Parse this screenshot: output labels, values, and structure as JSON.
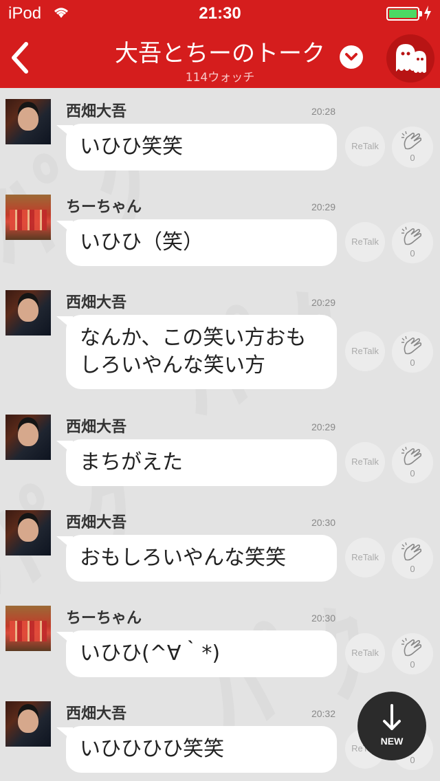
{
  "status_bar": {
    "carrier": "iPod",
    "time": "21:30",
    "battery_level": 1.0
  },
  "header": {
    "title": "大吾とちーのトーク",
    "subtitle": "114ウォッチ"
  },
  "messages": [
    {
      "sender": "西畑大吾",
      "time": "20:28",
      "text": "いひひ笑笑",
      "retalk_label": "ReTalk",
      "clap_count": "0"
    },
    {
      "sender": "ちーちゃん",
      "time": "20:29",
      "text": "いひひ（笑）",
      "retalk_label": "ReTalk",
      "clap_count": "0"
    },
    {
      "sender": "西畑大吾",
      "time": "20:29",
      "text_line1": "なんか、この笑い方おも",
      "text_line2": "しろいやんな笑い方",
      "retalk_label": "ReTalk",
      "clap_count": "0"
    },
    {
      "sender": "西畑大吾",
      "time": "20:29",
      "text": "まちがえた",
      "retalk_label": "ReTalk",
      "clap_count": "0"
    },
    {
      "sender": "西畑大吾",
      "time": "20:30",
      "text": "おもしろいやんな笑笑",
      "retalk_label": "ReTalk",
      "clap_count": "0"
    },
    {
      "sender": "ちーちゃん",
      "time": "20:30",
      "text": "いひひ(^∀｀*)",
      "retalk_label": "ReTalk",
      "clap_count": "0"
    },
    {
      "sender": "西畑大吾",
      "time": "20:32",
      "text": "いひひひひ笑笑",
      "retalk_label": "ReTalk",
      "clap_count": "0"
    }
  ],
  "new_button": {
    "label": "NEW"
  },
  "colors": {
    "header_bg": "#d51d1d",
    "chat_bg": "#e3e3e3",
    "bubble_bg": "#ffffff",
    "battery": "#4cd964"
  },
  "icons": {
    "back": "chevron-left-icon",
    "dropdown": "chevron-down-icon",
    "mascot": "ghost-mascot-icon",
    "clap": "clapping-hands-icon",
    "new": "arrow-down-icon"
  }
}
